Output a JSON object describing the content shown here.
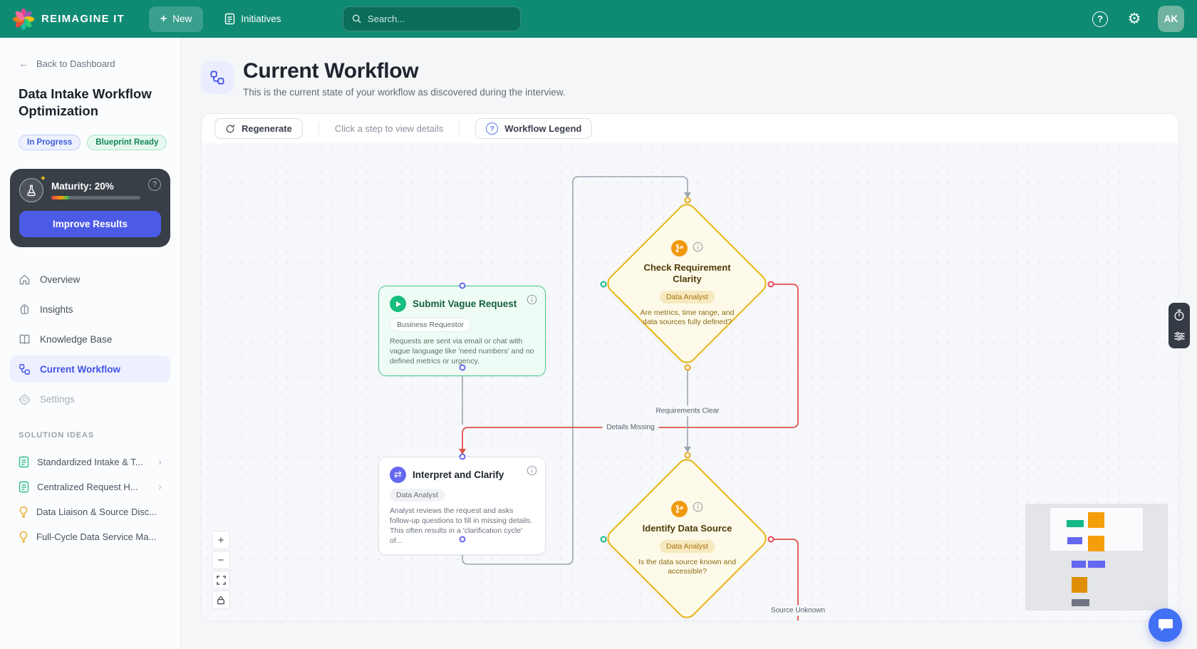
{
  "topbar": {
    "brand": "REIMAGINE IT",
    "new_button": "New",
    "initiatives": "Initiatives",
    "search_placeholder": "Search...",
    "avatar_initials": "AK"
  },
  "sidebar": {
    "back": "Back to Dashboard",
    "project_title": "Data Intake Workflow Optimization",
    "status_badges": [
      {
        "label": "In Progress",
        "color": "#3D5BD7"
      },
      {
        "label": "Blueprint Ready",
        "color": "#15865A"
      }
    ],
    "maturity": {
      "label": "Maturity: 20%",
      "percent": 20,
      "cta": "Improve Results"
    },
    "nav": [
      {
        "label": "Overview",
        "icon": "home-icon",
        "state": "default"
      },
      {
        "label": "Insights",
        "icon": "brain-icon",
        "state": "default"
      },
      {
        "label": "Knowledge Base",
        "icon": "book-icon",
        "state": "default"
      },
      {
        "label": "Current Workflow",
        "icon": "workflow-icon",
        "state": "active"
      },
      {
        "label": "Settings",
        "icon": "gear-icon",
        "state": "disabled"
      }
    ],
    "solution_ideas": {
      "heading": "SOLUTION IDEAS",
      "items": [
        {
          "label": "Standardized Intake & T...",
          "icon": "document-icon",
          "chevron": true
        },
        {
          "label": "Centralized Request H...",
          "icon": "document-icon",
          "chevron": true
        },
        {
          "label": "Data Liaison & Source Disc...",
          "icon": "lightbulb-icon",
          "chevron": false
        },
        {
          "label": "Full-Cycle Data Service Ma...",
          "icon": "lightbulb-icon",
          "chevron": false
        }
      ]
    }
  },
  "main": {
    "title": "Current Workflow",
    "subtitle": "This is the current state of your workflow as discovered during the interview.",
    "toolbar": {
      "regenerate": "Regenerate",
      "hint": "Click a step to view details",
      "legend": "Workflow Legend"
    }
  },
  "workflow": {
    "nodes": [
      {
        "title": "Submit Vague Request",
        "role": "Business Requestor",
        "type": "start",
        "description": "Requests are sent via email or chat with vague language like 'need numbers' and no defined metrics or urgency."
      },
      {
        "title": "Check Requirement Clarity",
        "role": "Data Analyst",
        "type": "decision",
        "description": "Are metrics, time range, and data sources fully defined?"
      },
      {
        "title": "Interpret and Clarify",
        "role": "Data Analyst",
        "type": "process",
        "description": "Analyst reviews the request and asks follow-up questions to fill in missing details. This often results in a 'clarification cycle' of..."
      },
      {
        "title": "Identify Data Source",
        "role": "Data Analyst",
        "type": "decision",
        "description": "Is the data source known and accessible?"
      }
    ],
    "edge_labels": [
      {
        "text": "Requirements Clear"
      },
      {
        "text": "Details Missing"
      },
      {
        "text": "Source Unknown"
      }
    ]
  },
  "icons": {
    "plus": "+",
    "back_arrow": "←",
    "chevron_right": "›",
    "help": "?",
    "gear": "⚙",
    "swap_arrows": "⇄",
    "sparkle": "✦",
    "zoom_in": "+",
    "zoom_out": "−"
  },
  "colors": {
    "topbar": "#0F8A73",
    "accent_indigo": "#4353E8",
    "green_node": "#45C98F",
    "amber_node": "#E8B616",
    "red_edge": "#E0524C",
    "gray_edge": "#9AA4B2",
    "improve_button": "#4B5BE6",
    "chat_bubble": "#4170F4"
  }
}
